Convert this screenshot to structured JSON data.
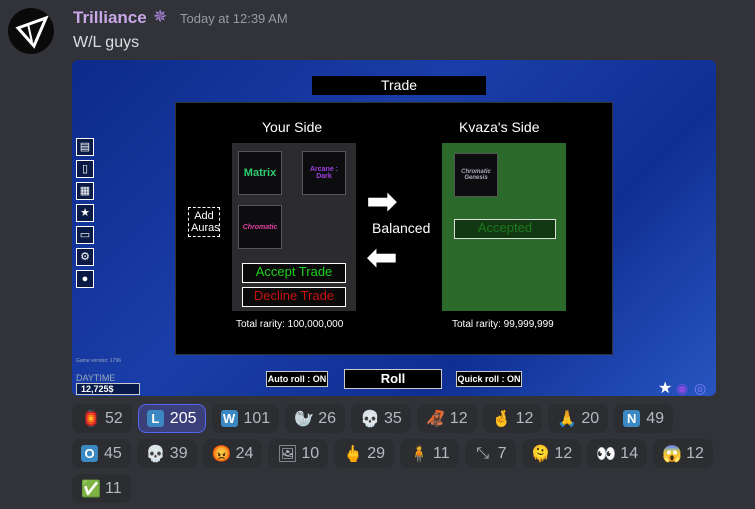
{
  "message": {
    "username": "Trilliance",
    "badge_icon": "sparkle-star-icon",
    "timestamp": "Today at 12:39 AM",
    "text": "W/L guys"
  },
  "game": {
    "trade_title": "Trade",
    "your_side": "Your Side",
    "their_side": "Kvaza's Side",
    "your_auras": [
      "Matrix",
      "Arcane : Dark",
      "Chromatic"
    ],
    "their_auras": [
      "Chromatic Genesis"
    ],
    "add_auras": "Add Auras",
    "balanced": "Balanced",
    "accepted": "Accepted",
    "accept_trade": "Accept Trade",
    "decline_trade": "Decline Trade",
    "your_total": "Total rarity: 100,000,000",
    "their_total": "Total rarity: 99,999,999",
    "game_version": "Game version: 1796",
    "daytime": "DAYTIME",
    "money": "12,725$",
    "auto_roll": "Auto roll : ON",
    "roll": "Roll",
    "quick_roll": "Quick roll : ON"
  },
  "reactions": [
    {
      "emoji": "🏮",
      "icon": "red-lantern-icon",
      "count": "52"
    },
    {
      "emoji": "L",
      "icon": "letter-l-icon",
      "count": "205",
      "active": true
    },
    {
      "emoji": "W",
      "icon": "letter-w-icon",
      "count": "101"
    },
    {
      "emoji": "🦭",
      "icon": "seal-face-icon",
      "count": "26"
    },
    {
      "emoji": "💀",
      "icon": "skull-icon",
      "count": "35"
    },
    {
      "emoji": "🦧",
      "icon": "orangutan-icon",
      "count": "12"
    },
    {
      "emoji": "🤞",
      "icon": "crossed-fingers-icon",
      "count": "12"
    },
    {
      "emoji": "🙏",
      "icon": "folded-hands-icon",
      "count": "20"
    },
    {
      "emoji": "N",
      "icon": "letter-n-icon",
      "count": "49"
    },
    {
      "emoji": "O",
      "icon": "letter-o-icon",
      "count": "45"
    },
    {
      "emoji": "💀",
      "icon": "skull-icon",
      "count": "39"
    },
    {
      "emoji": "😡",
      "icon": "angry-face-icon",
      "count": "24"
    },
    {
      "emoji": "🖼",
      "icon": "false-meme-icon",
      "count": "10"
    },
    {
      "emoji": "🖕",
      "icon": "middle-finger-icon",
      "count": "29"
    },
    {
      "emoji": "🧍",
      "icon": "person-photo-icon",
      "count": "11"
    },
    {
      "emoji": "⤡",
      "icon": "arrows-icon",
      "count": "7"
    },
    {
      "emoji": "🫠",
      "icon": "melting-face-icon",
      "count": "12"
    },
    {
      "emoji": "👀",
      "icon": "eyes-icon",
      "count": "14"
    },
    {
      "emoji": "😱",
      "icon": "screaming-face-icon",
      "count": "12"
    },
    {
      "emoji": "✅",
      "icon": "check-mark-icon",
      "count": "11"
    }
  ]
}
